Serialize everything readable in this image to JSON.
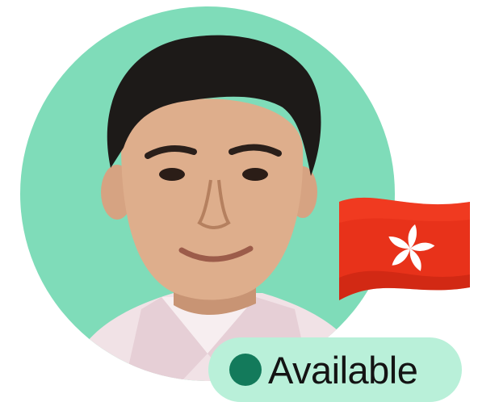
{
  "profile": {
    "avatar_icon": "person-photo",
    "avatar_bg_color": "#7fdcb9",
    "country_flag_icon": "hong-kong-flag-icon",
    "flag_color": "#e8321a"
  },
  "status": {
    "label": "Available",
    "dot_color": "#137a5b",
    "badge_color": "#b9f0d9"
  }
}
